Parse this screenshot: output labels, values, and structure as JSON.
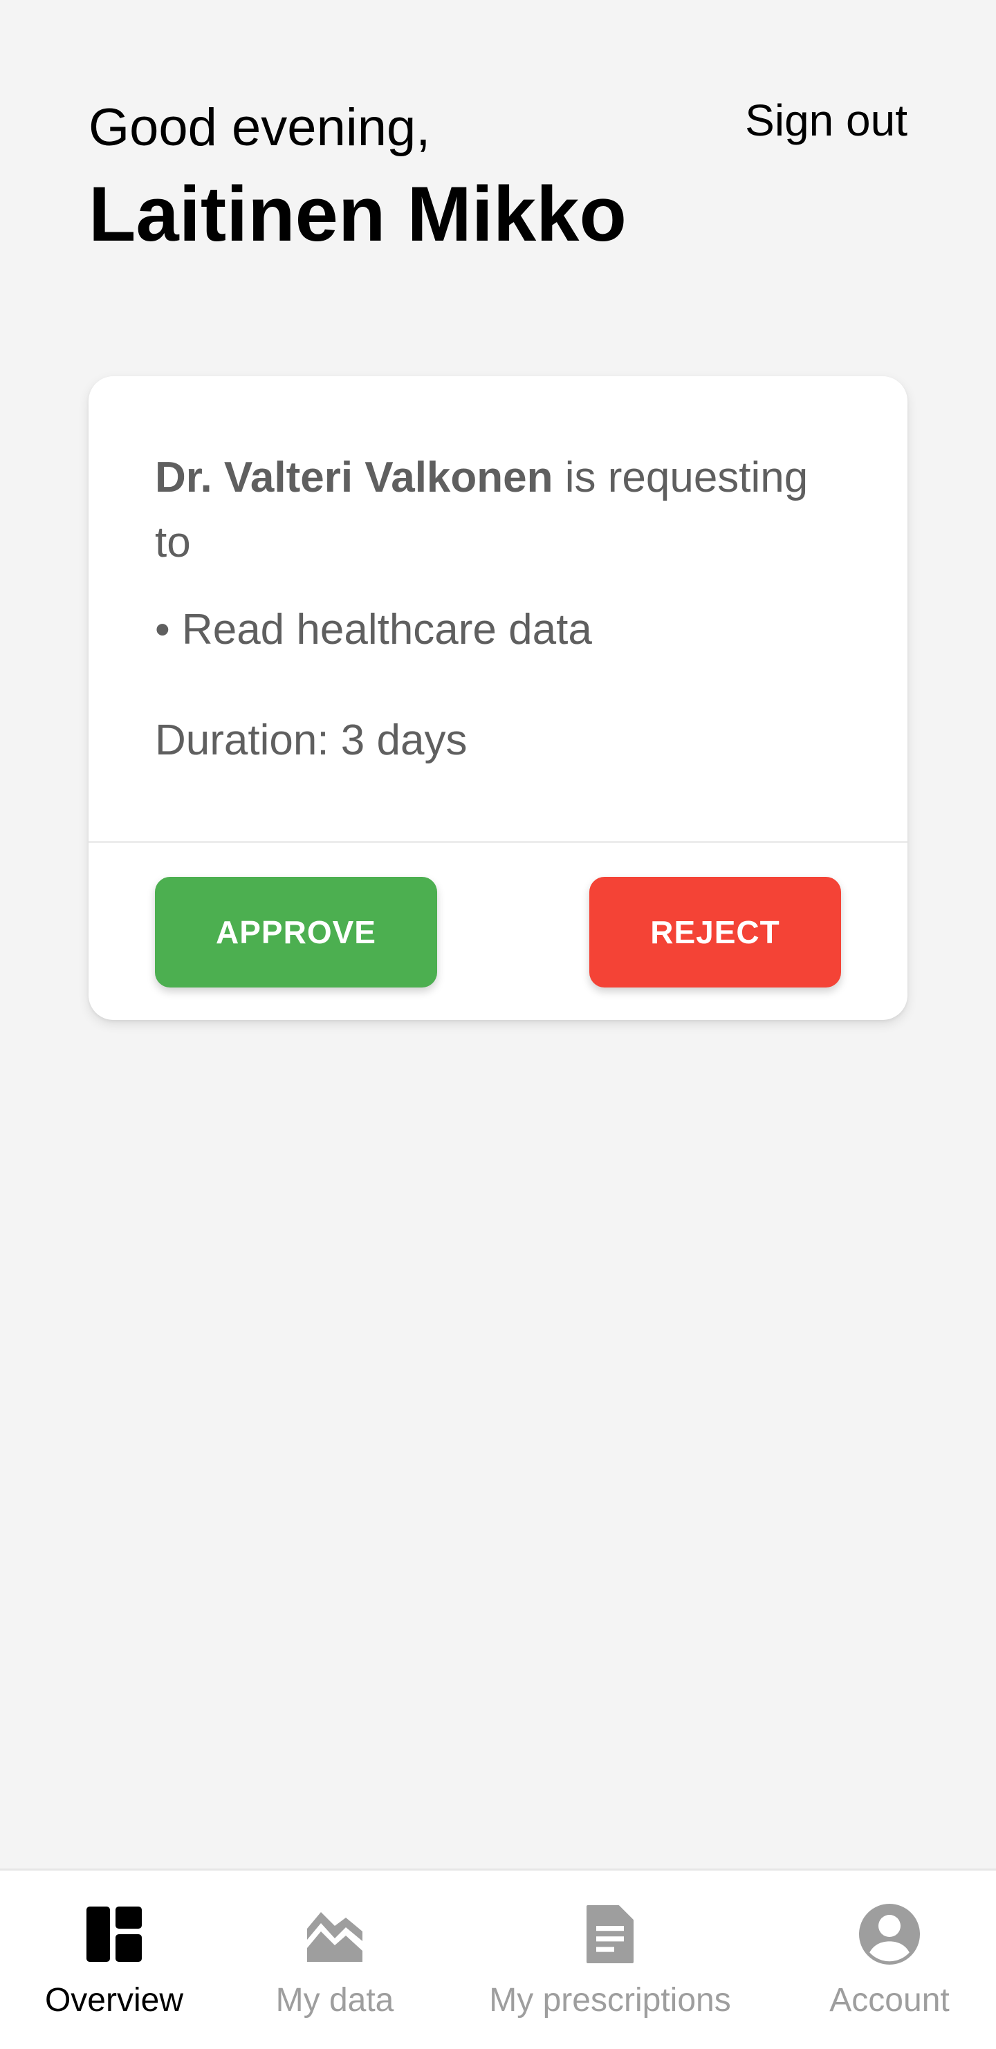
{
  "header": {
    "greeting": "Good evening,",
    "user_name": "Laitinen Mikko",
    "sign_out_label": "Sign out"
  },
  "request_card": {
    "requester": "Dr. Valteri Valkonen",
    "request_text": " is requesting to",
    "permission": "• Read healthcare data",
    "duration": "Duration: 3 days",
    "approve_label": "APPROVE",
    "reject_label": "REJECT",
    "approve_color": "#4caf50",
    "reject_color": "#f44336"
  },
  "bottom_nav": {
    "items": [
      {
        "label": "Overview",
        "icon": "dashboard-icon",
        "active": true
      },
      {
        "label": "My data",
        "icon": "chart-icon",
        "active": false
      },
      {
        "label": "My prescriptions",
        "icon": "document-icon",
        "active": false
      },
      {
        "label": "Account",
        "icon": "account-icon",
        "active": false
      }
    ],
    "active_color": "#000000",
    "inactive_color": "#9e9e9e"
  }
}
